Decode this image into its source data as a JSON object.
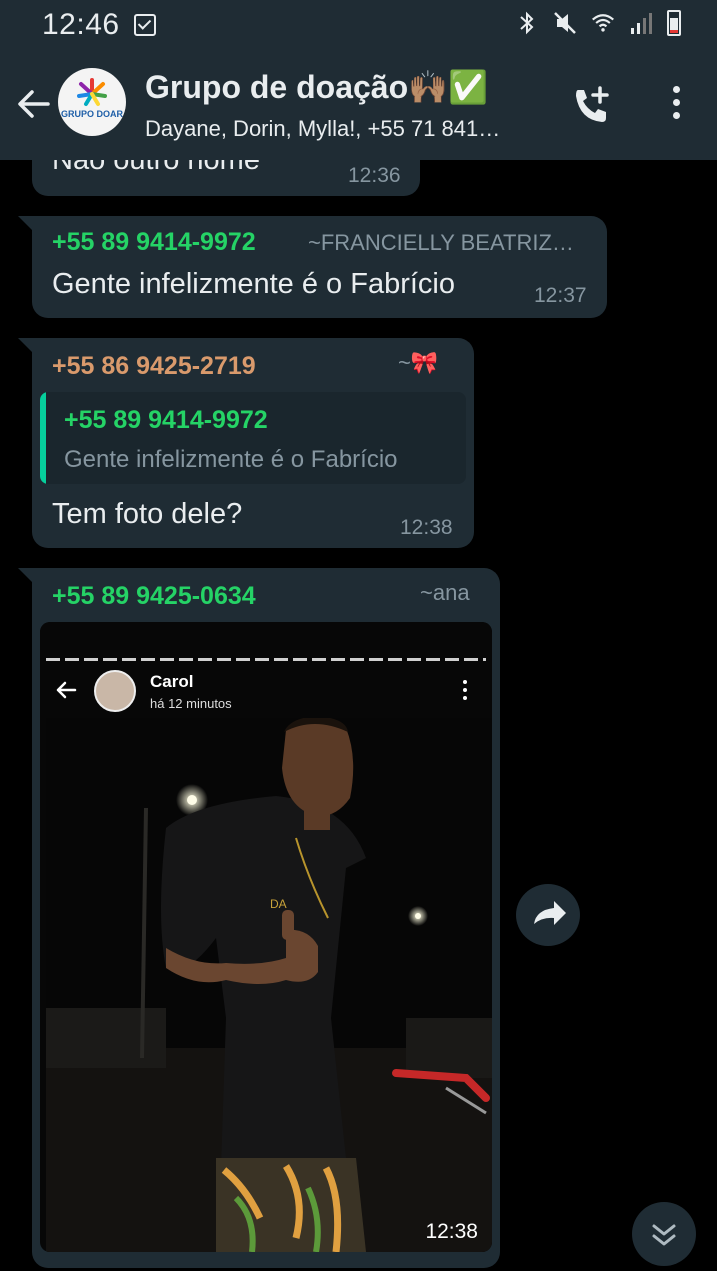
{
  "status_bar": {
    "time": "12:46"
  },
  "header": {
    "back_label": "back",
    "group_name": "Grupo de doação🙌🏽✅",
    "avatar_text": "GRUPO DOAR",
    "participants": "Dayane, Dorin, Mylla!, +55 71 841…"
  },
  "messages": [
    {
      "text": "Não outro nome",
      "time": "12:36"
    },
    {
      "sender": "+55 89 9414-9972",
      "pushname": "~FRANCIELLY BEATRIZ…",
      "text": "Gente infelizmente é o Fabrício",
      "time": "12:37",
      "sender_color": "#25d366"
    },
    {
      "sender": "+55 86 9425-2719",
      "pushname": "~🎀",
      "sender_color": "#d99a6c",
      "quote": {
        "sender": "+55 89 9414-9972",
        "text": "Gente infelizmente é o Fabrício"
      },
      "text": "Tem foto dele?",
      "time": "12:38"
    },
    {
      "sender": "+55 89 9425-0634",
      "pushname": "~ana",
      "sender_color": "#25d366",
      "image": {
        "story_name": "Carol",
        "story_ago": "há 12 minutos"
      },
      "time": "12:38"
    }
  ],
  "colors": {
    "bubble": "#1f2c34",
    "background": "#000000",
    "accent": "#25d366"
  },
  "icons": [
    "back-arrow-icon",
    "call-add-icon",
    "more-vert-icon",
    "forward-icon",
    "scroll-down-icon"
  ]
}
